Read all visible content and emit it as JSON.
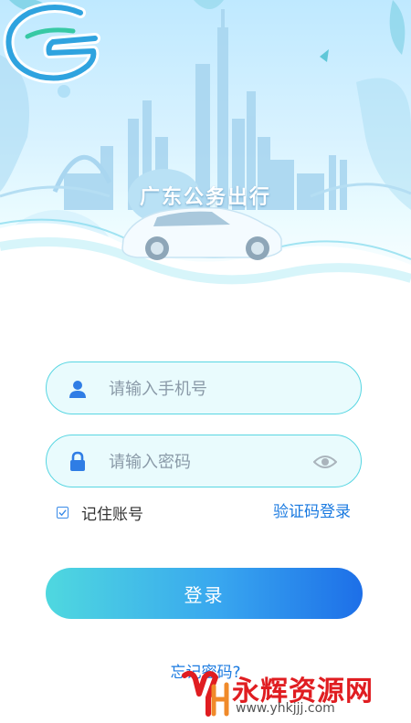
{
  "app": {
    "title": "广东公务出行"
  },
  "login": {
    "phone_placeholder": "请输入手机号",
    "password_placeholder": "请输入密码",
    "remember_label": "记住账号",
    "remember_checked": true,
    "sms_login_label": "验证码登录",
    "login_button_label": "登录",
    "forgot_password_label": "忘记密码?"
  },
  "watermark": {
    "name": "永辉资源网",
    "url": "www.yhkjjj.com"
  },
  "colors": {
    "accent_blue": "#1a7ae0",
    "field_border": "#58d6e2",
    "button_start": "#4fd8df",
    "button_end": "#1d6fe8",
    "watermark_red": "#e01d21"
  },
  "icons": {
    "phone_field": "user-icon",
    "password_field": "lock-icon",
    "toggle_visibility": "eye-icon"
  }
}
